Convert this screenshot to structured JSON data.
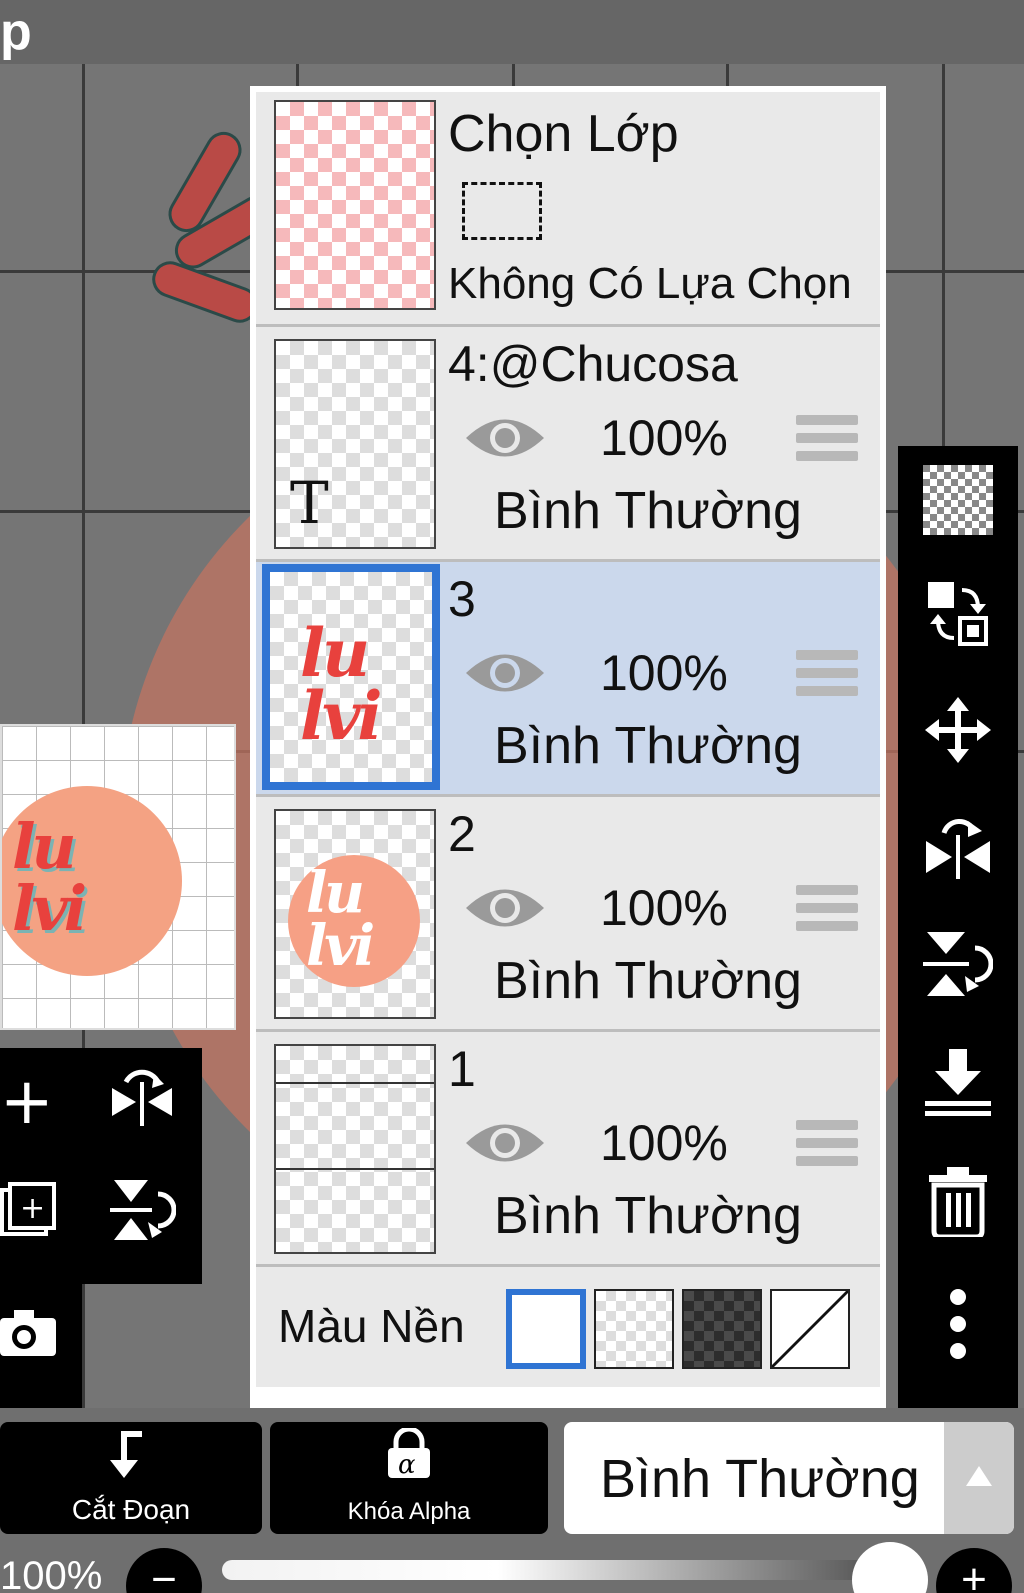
{
  "app": {
    "title_fragment": "p"
  },
  "layer_panel": {
    "selection_layer": {
      "title": "Chọn Lớp",
      "status": "Không Có Lựa Chọn"
    },
    "layers": [
      {
        "name": "4:@Chucosa",
        "opacity": "100%",
        "blend": "Bình Thường",
        "visible": true,
        "selected": false,
        "thumb_text": "T"
      },
      {
        "name": "3",
        "opacity": "100%",
        "blend": "Bình Thường",
        "visible": true,
        "selected": true
      },
      {
        "name": "2",
        "opacity": "100%",
        "blend": "Bình Thường",
        "visible": true,
        "selected": false
      },
      {
        "name": "1",
        "opacity": "100%",
        "blend": "Bình Thường",
        "visible": true,
        "selected": false
      }
    ],
    "background": {
      "label": "Màu Nền",
      "options": [
        "white",
        "transparent-light",
        "transparent-dark",
        "none"
      ],
      "selected": "white"
    }
  },
  "bottom_bar": {
    "clipping_label": "Cắt Đoạn",
    "alpha_lock_label": "Khóa Alpha",
    "blend_mode": "Bình Thường",
    "zoom": "100%"
  },
  "right_toolbar": [
    "checker-fill-icon",
    "swap-icon",
    "move-icon",
    "flip-horizontal-icon",
    "flip-vertical-icon",
    "merge-down-icon",
    "trash-icon",
    "more-icon"
  ],
  "left_toolbar": [
    "add-layer-icon",
    "flip-horizontal-icon",
    "add-layer-copy-icon",
    "flip-vertical-icon",
    "camera-icon"
  ],
  "colors": {
    "selected_row": "#cbd8ec",
    "accent": "#2f74d3",
    "row_bg": "#e9e9e9"
  }
}
